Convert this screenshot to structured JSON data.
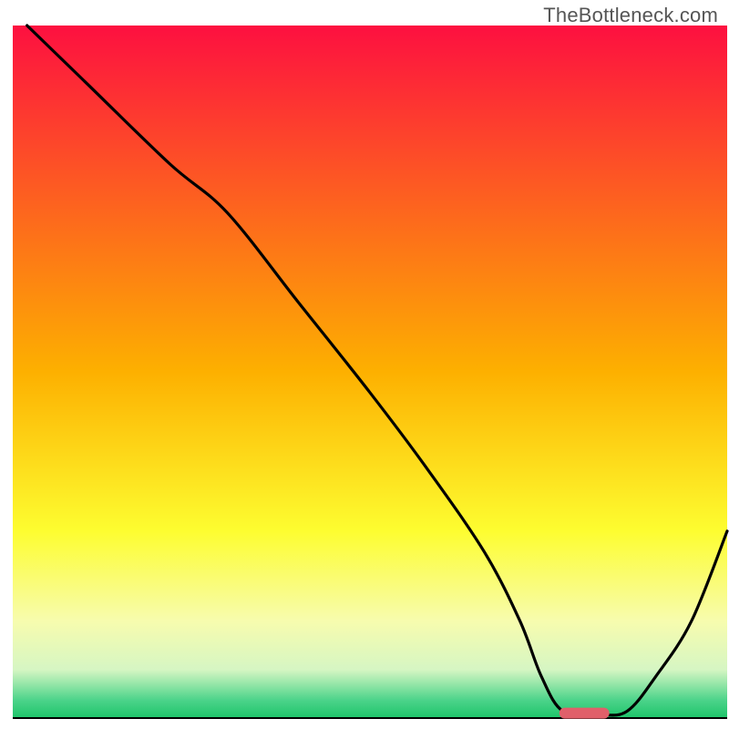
{
  "watermark": "TheBottleneck.com",
  "chart_data": {
    "type": "line",
    "title": "",
    "xlabel": "",
    "ylabel": "",
    "xlim": [
      0,
      100
    ],
    "ylim": [
      0,
      100
    ],
    "background_gradient": {
      "stops": [
        {
          "offset": 0.0,
          "color": "#fd1040"
        },
        {
          "offset": 0.5,
          "color": "#fdb000"
        },
        {
          "offset": 0.73,
          "color": "#fdfd30"
        },
        {
          "offset": 0.86,
          "color": "#f7fcae"
        },
        {
          "offset": 0.93,
          "color": "#d6f6c3"
        },
        {
          "offset": 0.975,
          "color": "#4ad389"
        },
        {
          "offset": 1.0,
          "color": "#1ec46a"
        }
      ]
    },
    "series": [
      {
        "name": "bottleneck-curve",
        "x": [
          2,
          10,
          22,
          30,
          40,
          50,
          58,
          66,
          71,
          74,
          77,
          82,
          86,
          90,
          95,
          100
        ],
        "y": [
          100,
          92,
          80,
          73,
          60,
          47,
          36,
          24,
          14,
          6,
          1,
          0.5,
          1,
          6,
          14,
          27
        ]
      }
    ],
    "marker": {
      "name": "optimal-range",
      "x_center": 80,
      "x_halfwidth": 3.5,
      "y": 0.7,
      "color": "#e0606a"
    },
    "baseline": {
      "y": 0,
      "color": "#000000"
    }
  }
}
